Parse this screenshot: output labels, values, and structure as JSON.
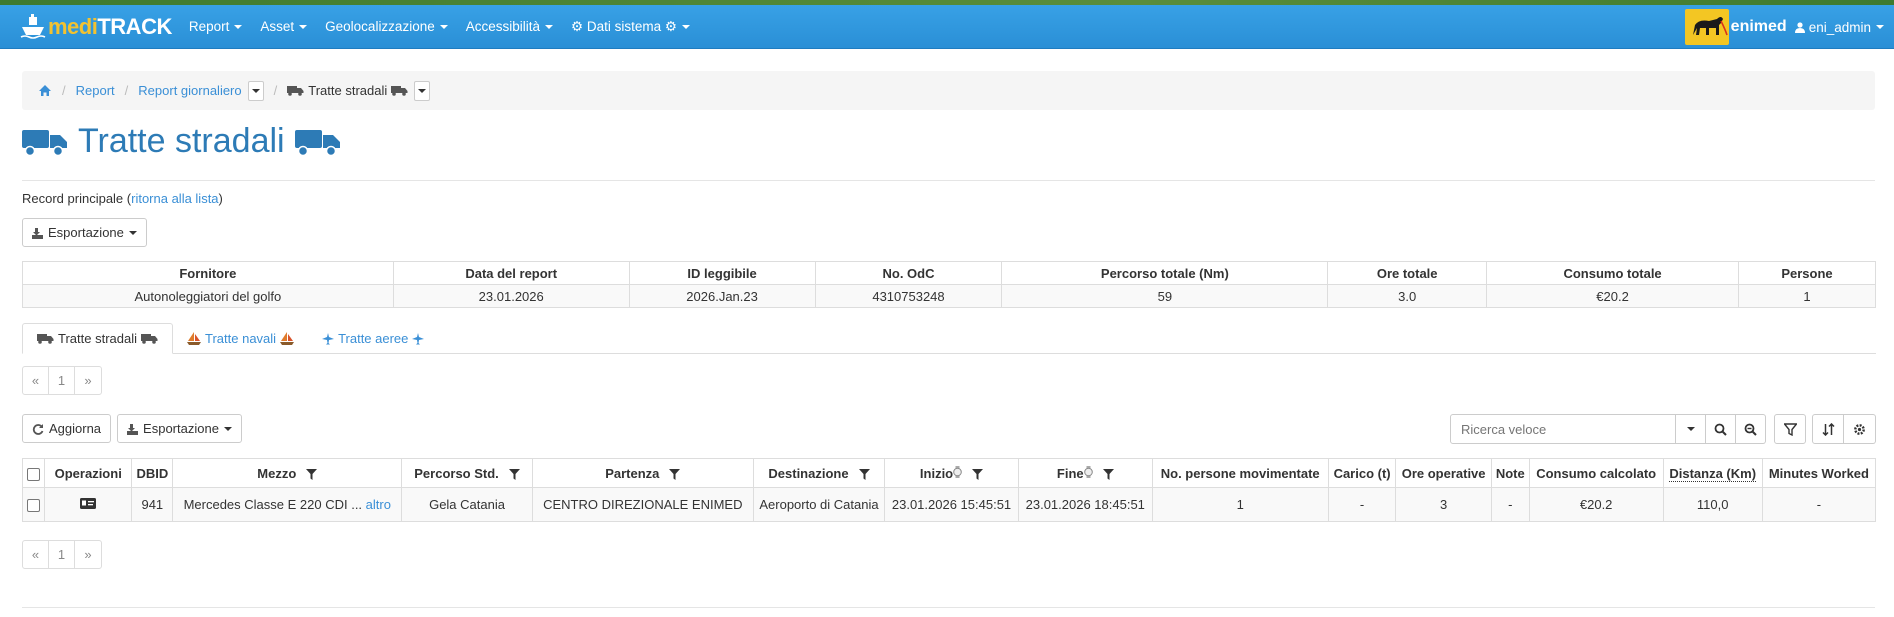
{
  "app": {
    "brand_part1": "medi",
    "brand_part2": "TRACK",
    "partner_part1": "eni",
    "partner_part2": "med",
    "user": "eni_admin",
    "colors": {
      "navbar": "#2a8fd6",
      "link": "#3a8fd6",
      "title": "#2d7bb6",
      "brand_accent": "#f2c230"
    }
  },
  "nav": {
    "items": [
      {
        "label": "Report"
      },
      {
        "label": "Asset"
      },
      {
        "label": "Geolocalizzazione"
      },
      {
        "label": "Accessibilità"
      },
      {
        "label": "⚙ Dati sistema ⚙"
      }
    ]
  },
  "breadcrumb": {
    "home_icon": "home-icon",
    "items": [
      "Report",
      "Report giornaliero",
      "Tratte stradali"
    ]
  },
  "page": {
    "title": "Tratte stradali",
    "title_icon": "truck-icon",
    "record_prefix": "Record principale (",
    "record_link": "ritorna alla lista",
    "record_suffix": ")",
    "export_label": "Esportazione"
  },
  "summary": {
    "headers": [
      "Fornitore",
      "Data del report",
      "ID leggibile",
      "No. OdC",
      "Percorso totale (Nm)",
      "Ore totale",
      "Consumo totale",
      "Persone"
    ],
    "row": [
      "Autonoleggiatori del golfo",
      "23.01.2026",
      "2026.Jan.23",
      "4310753248",
      "59",
      "3.0",
      "€20.2",
      "1"
    ]
  },
  "tabs": [
    {
      "label": "Tratte stradali",
      "icon": "truck-icon",
      "active": true
    },
    {
      "label": "Tratte navali",
      "icon": "sailboat-icon",
      "active": false
    },
    {
      "label": "Tratte aeree",
      "icon": "airplane-icon",
      "active": false
    }
  ],
  "pager": {
    "prev": "«",
    "page": "1",
    "next": "»"
  },
  "toolbar": {
    "refresh_label": "Aggiorna",
    "export_label": "Esportazione",
    "search_placeholder": "Ricerca veloce"
  },
  "grid": {
    "headers": [
      "Operazioni",
      "DBID",
      "Mezzo",
      "Percorso Std.",
      "Partenza",
      "Destinazione",
      "Inizio",
      "Fine",
      "No. persone movimentate",
      "Carico (t)",
      "Ore operative",
      "Note",
      "Consumo calcolato",
      "Distanza (Km)",
      "Minutes Worked"
    ],
    "rows": [
      {
        "dbid": "941",
        "mezzo": "Mercedes Classe E 220 CDI ...",
        "mezzo_more": "altro",
        "percorso": "Gela Catania",
        "partenza": "CENTRO DIREZIONALE ENIMED",
        "destinazione": "Aeroporto di Catania",
        "inizio": "23.01.2026 15:45:51",
        "fine": "23.01.2026 18:45:51",
        "persone": "1",
        "carico": "-",
        "ore": "3",
        "note": "-",
        "consumo": "€20.2",
        "distanza": "110,0",
        "minutes": "-"
      }
    ]
  }
}
